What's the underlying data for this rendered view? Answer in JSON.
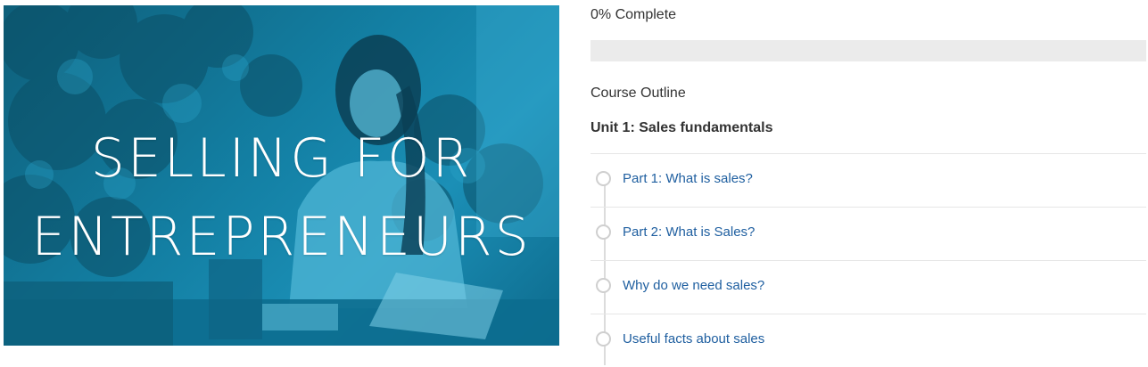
{
  "hero": {
    "title_line1": "SELLING FOR",
    "title_line2": "ENTREPRENEURS"
  },
  "progress": {
    "text": "0% Complete",
    "percent": 0,
    "fill_color": "#2e7bb8",
    "track_color": "#ebebeb"
  },
  "outline": {
    "heading": "Course Outline",
    "unit_title": "Unit 1: Sales fundamentals",
    "lessons": [
      {
        "label": "Part 1: What is sales?"
      },
      {
        "label": "Part 2: What is Sales?"
      },
      {
        "label": "Why do we need sales?"
      },
      {
        "label": "Useful facts about sales"
      }
    ]
  },
  "colors": {
    "link": "#1f5fa0",
    "hero_tint": "#137fa3"
  }
}
